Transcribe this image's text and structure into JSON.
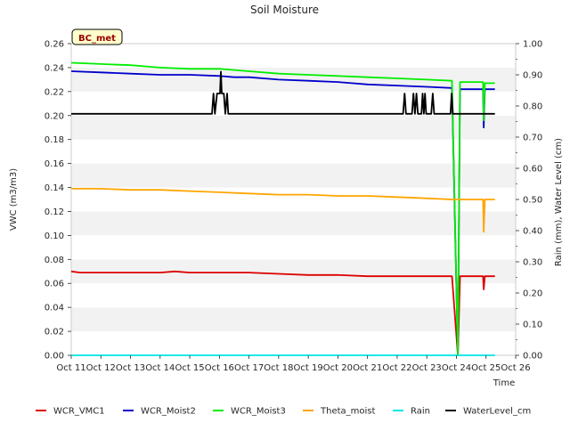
{
  "chart_data": {
    "type": "line",
    "title": "Soil Moisture",
    "xlabel": "Time",
    "ylabel_left": "VWC (m3/m3)",
    "ylabel_right": "Rain (mm), Water Level (cm)",
    "station_label": "BC_met",
    "x_range": [
      11,
      26
    ],
    "ylim_left": [
      0,
      0.26
    ],
    "ylim_right": [
      0,
      1.0
    ],
    "x_ticks": [
      {
        "v": 11,
        "label": "Oct 11"
      },
      {
        "v": 12,
        "label": "Oct 12"
      },
      {
        "v": 13,
        "label": "Oct 13"
      },
      {
        "v": 14,
        "label": "Oct 14"
      },
      {
        "v": 15,
        "label": "Oct 15"
      },
      {
        "v": 16,
        "label": "Oct 16"
      },
      {
        "v": 17,
        "label": "Oct 17"
      },
      {
        "v": 18,
        "label": "Oct 18"
      },
      {
        "v": 19,
        "label": "Oct 19"
      },
      {
        "v": 20,
        "label": "Oct 20"
      },
      {
        "v": 21,
        "label": "Oct 21"
      },
      {
        "v": 22,
        "label": "Oct 22"
      },
      {
        "v": 23,
        "label": "Oct 23"
      },
      {
        "v": 24,
        "label": "Oct 24"
      },
      {
        "v": 25,
        "label": "Oct 25"
      },
      {
        "v": 26,
        "label": "Oct 26"
      }
    ],
    "y_ticks_left": [
      "0.00",
      "0.02",
      "0.04",
      "0.06",
      "0.08",
      "0.10",
      "0.12",
      "0.14",
      "0.16",
      "0.18",
      "0.20",
      "0.22",
      "0.24",
      "0.26"
    ],
    "y_ticks_right": [
      "0.00",
      "0.10",
      "0.20",
      "0.30",
      "0.40",
      "0.50",
      "0.60",
      "0.70",
      "0.80",
      "0.90",
      "1.00"
    ],
    "grid": "horizontal bands",
    "legend_position": "bottom",
    "series": [
      {
        "name": "WCR_VMC1",
        "axis": "left",
        "color": "#dd0000",
        "points": [
          [
            11.0,
            0.07
          ],
          [
            11.3,
            0.069
          ],
          [
            12,
            0.069
          ],
          [
            13,
            0.069
          ],
          [
            14,
            0.069
          ],
          [
            14.5,
            0.07
          ],
          [
            15,
            0.069
          ],
          [
            16,
            0.069
          ],
          [
            17,
            0.069
          ],
          [
            18,
            0.068
          ],
          [
            19,
            0.067
          ],
          [
            20,
            0.067
          ],
          [
            21,
            0.066
          ],
          [
            22,
            0.066
          ],
          [
            23,
            0.066
          ],
          [
            23.85,
            0.066
          ],
          [
            24.05,
            0.0
          ],
          [
            24.12,
            0.066
          ],
          [
            24.5,
            0.066
          ],
          [
            24.9,
            0.066
          ],
          [
            24.92,
            0.055
          ],
          [
            24.96,
            0.066
          ],
          [
            25.3,
            0.066
          ]
        ]
      },
      {
        "name": "WCR_Moist2",
        "axis": "left",
        "color": "#0000cc",
        "points": [
          [
            11.0,
            0.237
          ],
          [
            12,
            0.236
          ],
          [
            13,
            0.235
          ],
          [
            14,
            0.234
          ],
          [
            15,
            0.234
          ],
          [
            16,
            0.233
          ],
          [
            16.5,
            0.232
          ],
          [
            17,
            0.232
          ],
          [
            18,
            0.23
          ],
          [
            19,
            0.229
          ],
          [
            20,
            0.228
          ],
          [
            21,
            0.226
          ],
          [
            22,
            0.225
          ],
          [
            23,
            0.224
          ],
          [
            23.85,
            0.223
          ],
          [
            24.05,
            0.0
          ],
          [
            24.12,
            0.222
          ],
          [
            24.5,
            0.222
          ],
          [
            24.9,
            0.222
          ],
          [
            24.92,
            0.19
          ],
          [
            24.96,
            0.222
          ],
          [
            25.3,
            0.222
          ]
        ]
      },
      {
        "name": "WCR_Moist3",
        "axis": "left",
        "color": "#00ee00",
        "points": [
          [
            11.0,
            0.244
          ],
          [
            12,
            0.243
          ],
          [
            13,
            0.242
          ],
          [
            14,
            0.24
          ],
          [
            15,
            0.239
          ],
          [
            16,
            0.239
          ],
          [
            16.5,
            0.238
          ],
          [
            17,
            0.237
          ],
          [
            18,
            0.235
          ],
          [
            19,
            0.234
          ],
          [
            20,
            0.233
          ],
          [
            21,
            0.232
          ],
          [
            22,
            0.231
          ],
          [
            23,
            0.23
          ],
          [
            23.85,
            0.229
          ],
          [
            24.05,
            0.0
          ],
          [
            24.12,
            0.228
          ],
          [
            24.5,
            0.228
          ],
          [
            24.9,
            0.228
          ],
          [
            24.92,
            0.196
          ],
          [
            24.96,
            0.227
          ],
          [
            25.3,
            0.227
          ]
        ]
      },
      {
        "name": "Theta_moist",
        "axis": "left",
        "color": "#ffa500",
        "points": [
          [
            11.0,
            0.139
          ],
          [
            12,
            0.139
          ],
          [
            13,
            0.138
          ],
          [
            14,
            0.138
          ],
          [
            15,
            0.137
          ],
          [
            16,
            0.136
          ],
          [
            17,
            0.135
          ],
          [
            18,
            0.134
          ],
          [
            19,
            0.134
          ],
          [
            20,
            0.133
          ],
          [
            21,
            0.133
          ],
          [
            22,
            0.132
          ],
          [
            23,
            0.131
          ],
          [
            23.85,
            0.13
          ],
          [
            24.5,
            0.13
          ],
          [
            24.9,
            0.13
          ],
          [
            24.92,
            0.103
          ],
          [
            24.96,
            0.13
          ],
          [
            25.3,
            0.13
          ]
        ]
      },
      {
        "name": "Rain",
        "axis": "right",
        "color": "#00e5e5",
        "points": [
          [
            11.0,
            0.0
          ],
          [
            25.3,
            0.0
          ]
        ]
      },
      {
        "name": "WaterLevel_cm",
        "axis": "right",
        "color": "#000000",
        "points": [
          [
            11.0,
            0.775
          ],
          [
            15.75,
            0.775
          ],
          [
            15.8,
            0.84
          ],
          [
            15.85,
            0.775
          ],
          [
            15.92,
            0.84
          ],
          [
            16.02,
            0.84
          ],
          [
            16.05,
            0.91
          ],
          [
            16.08,
            0.84
          ],
          [
            16.15,
            0.84
          ],
          [
            16.2,
            0.775
          ],
          [
            16.26,
            0.84
          ],
          [
            16.3,
            0.775
          ],
          [
            22.2,
            0.775
          ],
          [
            22.25,
            0.84
          ],
          [
            22.3,
            0.775
          ],
          [
            22.5,
            0.775
          ],
          [
            22.55,
            0.84
          ],
          [
            22.6,
            0.775
          ],
          [
            22.65,
            0.84
          ],
          [
            22.7,
            0.775
          ],
          [
            22.82,
            0.775
          ],
          [
            22.86,
            0.84
          ],
          [
            22.9,
            0.775
          ],
          [
            22.94,
            0.84
          ],
          [
            22.98,
            0.775
          ],
          [
            23.15,
            0.775
          ],
          [
            23.2,
            0.84
          ],
          [
            23.25,
            0.775
          ],
          [
            23.8,
            0.775
          ],
          [
            23.84,
            0.84
          ],
          [
            23.88,
            0.775
          ],
          [
            25.3,
            0.775
          ]
        ]
      }
    ]
  }
}
